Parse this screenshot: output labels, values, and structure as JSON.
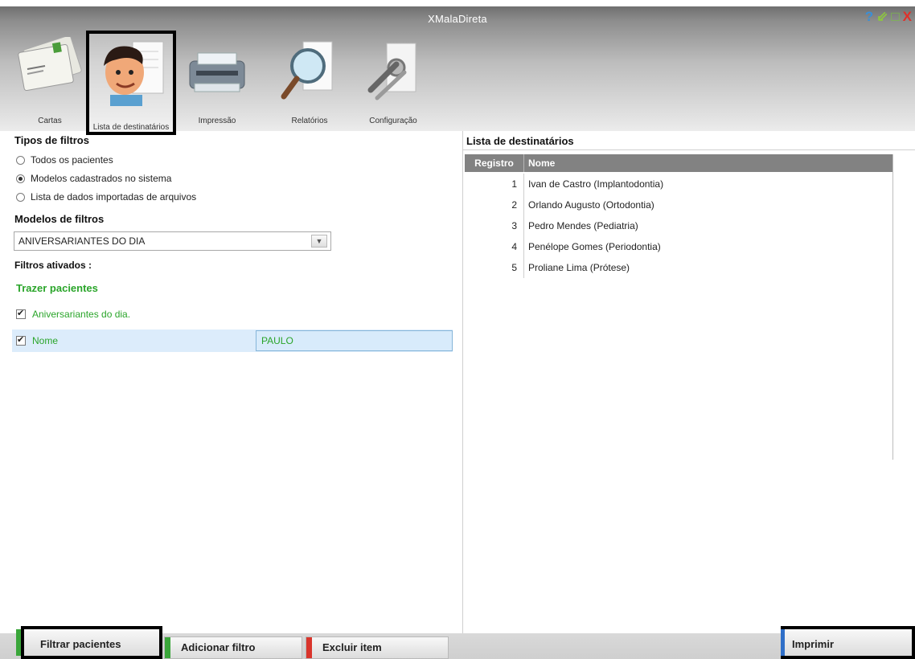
{
  "app": {
    "title": "XMalaDireta"
  },
  "window_controls": {
    "help": "?",
    "minimize": "⇙",
    "maximize": "□",
    "close": "X"
  },
  "toolbar": {
    "items": [
      {
        "label": "Cartas",
        "icon": "letters-icon"
      },
      {
        "label": "Lista de destinatários",
        "icon": "person-icon",
        "selected": true
      },
      {
        "label": "Impressão",
        "icon": "printer-icon"
      },
      {
        "label": "Relatórios",
        "icon": "magnifier-icon"
      },
      {
        "label": "Configuração",
        "icon": "tools-icon"
      }
    ]
  },
  "filters": {
    "types_title": "Tipos de filtros",
    "types": [
      {
        "label": "Todos os pacientes",
        "selected": false
      },
      {
        "label": "Modelos cadastrados no sistema",
        "selected": true
      },
      {
        "label": "Lista de dados importadas de arquivos",
        "selected": false
      }
    ],
    "models_title": "Modelos de filtros",
    "model_selected": "ANIVERSARIANTES DO DIA",
    "active_title": "Filtros ativados :",
    "bring_title": "Trazer pacientes",
    "active": [
      {
        "label": "Aniversariantes do dia.",
        "checked": true
      },
      {
        "label": "Nome",
        "checked": true,
        "value": "PAULO"
      }
    ]
  },
  "recipients": {
    "title": "Lista de destinatários",
    "columns": [
      "Registro",
      "Nome"
    ],
    "rows": [
      {
        "registro": "1",
        "nome": "Ivan de Castro (Implantodontia)"
      },
      {
        "registro": "2",
        "nome": "Orlando Augusto (Ortodontia)"
      },
      {
        "registro": "3",
        "nome": "Pedro Mendes (Pediatria)"
      },
      {
        "registro": "4",
        "nome": "Penélope Gomes (Periodontia)"
      },
      {
        "registro": "5",
        "nome": "Proliane Lima (Prótese)"
      }
    ]
  },
  "actions": {
    "filter": "Filtrar pacientes",
    "add_filter": "Adicionar filtro",
    "delete_item": "Excluir item",
    "print": "Imprimir"
  },
  "colors": {
    "filter_stripe": "#3aa63a",
    "add_stripe": "#3aa63a",
    "delete_stripe": "#d9342b",
    "print_stripe": "#2f6fc8",
    "active_filter_text": "#2aa52a"
  }
}
